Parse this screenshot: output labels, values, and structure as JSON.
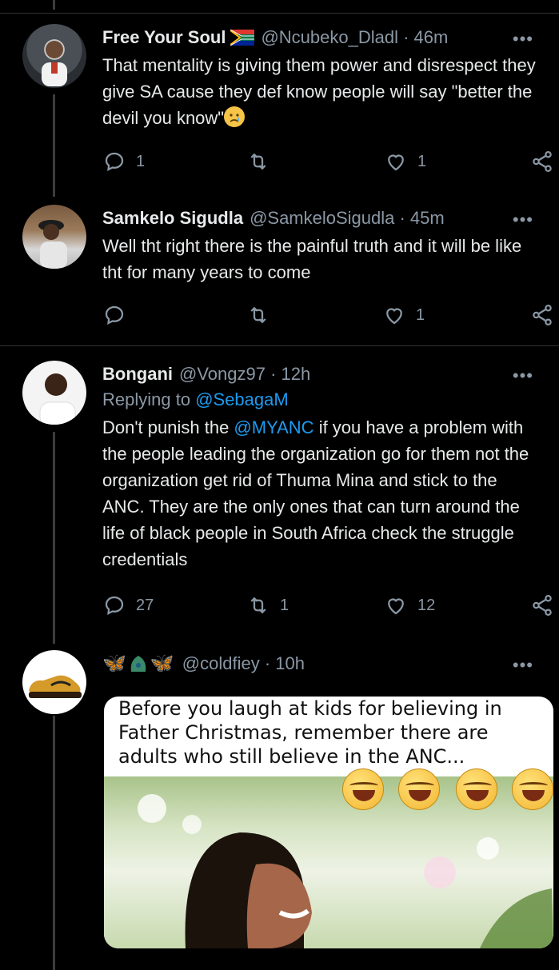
{
  "tweets": [
    {
      "name": "Free Your Soul",
      "handle": "@Ncubeko_Dladl · 46m",
      "text_parts": [
        "That mentality is giving them power and disrespect they give SA cause they def know people will say \"better the devil you know\""
      ],
      "replies": "1",
      "retweets": "",
      "likes": "1"
    },
    {
      "name": "Samkelo Sigudla",
      "handle": "@SamkeloSigudla · 45m",
      "text": "Well tht right there is the painful truth and it will be like tht for many years to come",
      "replies": "",
      "retweets": "",
      "likes": "1"
    },
    {
      "name": "Bongani",
      "handle": "@Vongz97 · 12h",
      "reply_prefix": "Replying to ",
      "reply_to": "@SebagaM",
      "text_before": "Don't punish the ",
      "mention": "@MYANC",
      "text_after": " if you have a problem with the people leading the organization go for them not the organization get rid of Thuma Mina and stick to the ANC. They are the only ones that can turn around the life of black people in South Africa check the struggle credentials",
      "replies": "27",
      "retweets": "1",
      "likes": "12"
    },
    {
      "name": "",
      "handle": "@coldfiey · 10h",
      "meme_text": "Before you laugh at kids for believing in Father Christmas, remember there are adults who still believe in the ANC..."
    }
  ],
  "more_label": "•••",
  "butterfly_glyph": "🦋",
  "colors": {
    "link": "#1d9bf0",
    "muted": "#8b98a5",
    "background": "#000000"
  }
}
